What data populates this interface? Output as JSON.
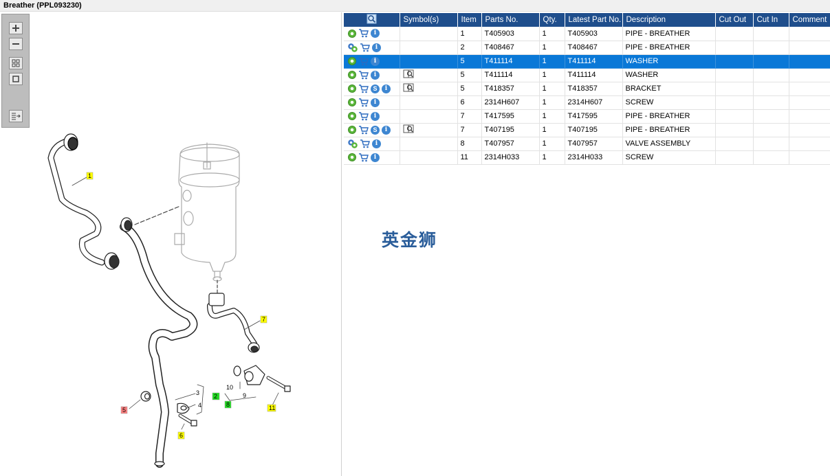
{
  "window": {
    "title": "Breather (PPL093230)"
  },
  "toolbox": {
    "buttons": [
      {
        "name": "zoom-in-button",
        "icon": "zoom-in-icon"
      },
      {
        "name": "zoom-out-button",
        "icon": "zoom-out-icon"
      },
      {
        "name": "fit-all-button",
        "icon": "fit-all-icon"
      },
      {
        "name": "fit-window-button",
        "icon": "fit-window-icon"
      },
      {
        "name": "export-button",
        "icon": "export-icon"
      }
    ]
  },
  "diagram": {
    "callouts": [
      {
        "text": "1",
        "color": "#ffff00"
      },
      {
        "text": "7",
        "color": "#ffff00"
      },
      {
        "text": "2",
        "color": "#22dd22"
      },
      {
        "text": "8",
        "color": "#22dd22"
      },
      {
        "text": "5",
        "color": "#ff8080"
      },
      {
        "text": "6",
        "color": "#ffff00"
      },
      {
        "text": "11",
        "color": "#ffff00"
      }
    ],
    "plain_labels": [
      "3",
      "4",
      "10",
      "9"
    ]
  },
  "table": {
    "columns": [
      "Symbol(s)",
      "Item",
      "Parts No.",
      "Qty.",
      "Latest Part No.",
      "Description",
      "Cut Out",
      "Cut In",
      "Comment"
    ],
    "rows": [
      {
        "icons": [
          "gear",
          "cart",
          "info"
        ],
        "book": false,
        "item": "1",
        "part": "T405903",
        "qty": "1",
        "latest": "T405903",
        "desc": "PIPE - BREATHER",
        "selected": false
      },
      {
        "icons": [
          "gear2",
          "cart",
          "info"
        ],
        "book": false,
        "item": "2",
        "part": "T408467",
        "qty": "1",
        "latest": "T408467",
        "desc": "PIPE - BREATHER",
        "selected": false
      },
      {
        "icons": [
          "gear",
          "cart",
          "info"
        ],
        "book": false,
        "item": "5",
        "part": "T411114",
        "qty": "1",
        "latest": "T411114",
        "desc": "WASHER",
        "selected": true
      },
      {
        "icons": [
          "gear",
          "cart",
          "info"
        ],
        "book": true,
        "item": "5",
        "part": "T411114",
        "qty": "1",
        "latest": "T411114",
        "desc": "WASHER",
        "selected": false
      },
      {
        "icons": [
          "gear",
          "cart",
          "s",
          "info"
        ],
        "book": true,
        "item": "5",
        "part": "T418357",
        "qty": "1",
        "latest": "T418357",
        "desc": "BRACKET",
        "selected": false
      },
      {
        "icons": [
          "gear",
          "cart",
          "info"
        ],
        "book": false,
        "item": "6",
        "part": "2314H607",
        "qty": "1",
        "latest": "2314H607",
        "desc": "SCREW",
        "selected": false
      },
      {
        "icons": [
          "gear",
          "cart",
          "info"
        ],
        "book": false,
        "item": "7",
        "part": "T417595",
        "qty": "1",
        "latest": "T417595",
        "desc": "PIPE - BREATHER",
        "selected": false
      },
      {
        "icons": [
          "gear",
          "cart",
          "s",
          "info"
        ],
        "book": true,
        "item": "7",
        "part": "T407195",
        "qty": "1",
        "latest": "T407195",
        "desc": "PIPE - BREATHER",
        "selected": false
      },
      {
        "icons": [
          "gear2",
          "cart",
          "info"
        ],
        "book": false,
        "item": "8",
        "part": "T407957",
        "qty": "1",
        "latest": "T407957",
        "desc": "VALVE ASSEMBLY",
        "selected": false
      },
      {
        "icons": [
          "gear",
          "cart",
          "info"
        ],
        "book": false,
        "item": "11",
        "part": "2314H033",
        "qty": "1",
        "latest": "2314H033",
        "desc": "SCREW",
        "selected": false
      }
    ]
  },
  "watermark": "英金狮",
  "colors": {
    "header_bg": "#1f4e8c",
    "selected_row": "#0a78d7"
  }
}
